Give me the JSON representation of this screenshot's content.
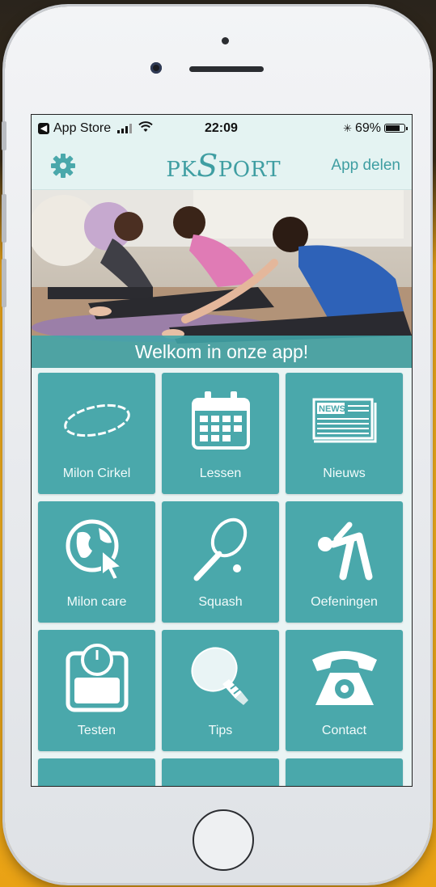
{
  "status_bar": {
    "back_app": "App Store",
    "time": "22:09",
    "bluetooth": "✳",
    "battery_percent": "69%",
    "battery_level": 0.69
  },
  "header": {
    "brand_pk": "PK",
    "brand_s": "S",
    "brand_port": "PORT",
    "share_label": "App delen"
  },
  "banner": {
    "welcome_text": "Welkom in onze app!"
  },
  "tiles": [
    {
      "label": "Milon Cirkel",
      "icon": "milon-ring-icon"
    },
    {
      "label": "Lessen",
      "icon": "calendar-icon"
    },
    {
      "label": "Nieuws",
      "icon": "newspaper-icon"
    },
    {
      "label": "Milon care",
      "icon": "globe-cursor-icon"
    },
    {
      "label": "Squash",
      "icon": "squash-racket-icon"
    },
    {
      "label": "Oefeningen",
      "icon": "exercise-figure-icon"
    },
    {
      "label": "Testen",
      "icon": "scale-icon"
    },
    {
      "label": "Tips",
      "icon": "lightbulb-icon"
    },
    {
      "label": "Contact",
      "icon": "telephone-icon"
    }
  ],
  "colors": {
    "accent": "#3f9ea2",
    "tile": "#4aa8ab",
    "header_bg": "#e4f3f2"
  }
}
